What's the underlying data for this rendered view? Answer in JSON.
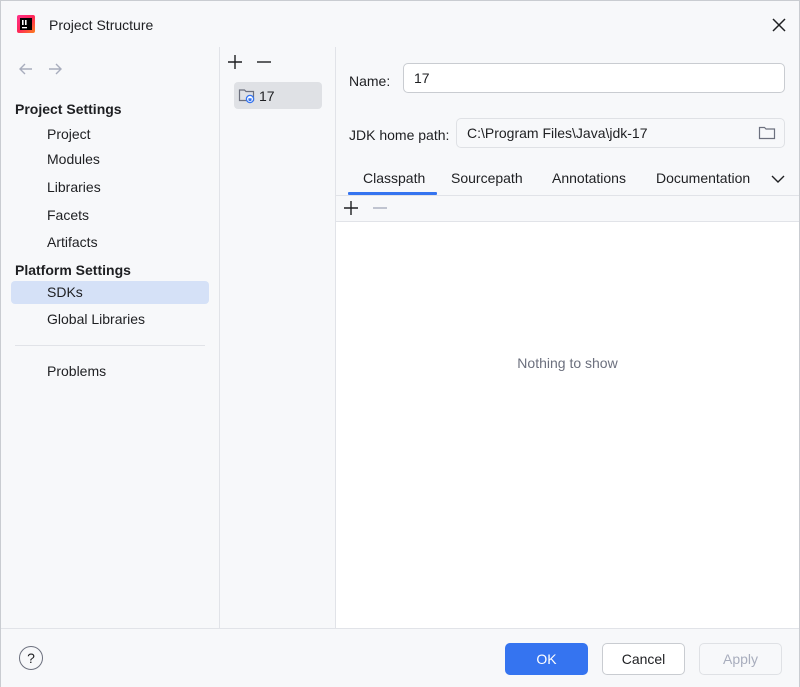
{
  "window": {
    "title": "Project Structure"
  },
  "sidebar": {
    "project_settings_header": "Project Settings",
    "project_items": [
      "Project",
      "Modules",
      "Libraries",
      "Facets",
      "Artifacts"
    ],
    "platform_settings_header": "Platform Settings",
    "platform_items": [
      "SDKs",
      "Global Libraries"
    ],
    "selected_item": "SDKs",
    "problems_label": "Problems"
  },
  "sdk_list": {
    "items": [
      "17"
    ],
    "selected": "17"
  },
  "detail": {
    "name_label": "Name:",
    "name_value": "17",
    "jdk_home_label": "JDK home path:",
    "jdk_home_value": "C:\\Program Files\\Java\\jdk-17",
    "tabs": [
      "Classpath",
      "Sourcepath",
      "Annotations",
      "Documentation"
    ],
    "active_tab": "Classpath",
    "empty_message": "Nothing to show"
  },
  "footer": {
    "help_label": "?",
    "ok_label": "OK",
    "cancel_label": "Cancel",
    "apply_label": "Apply"
  },
  "colors": {
    "accent": "#3574f0",
    "selection": "#d5e1f7",
    "muted_text": "#6c707e",
    "disabled_text": "#a8adbd"
  }
}
